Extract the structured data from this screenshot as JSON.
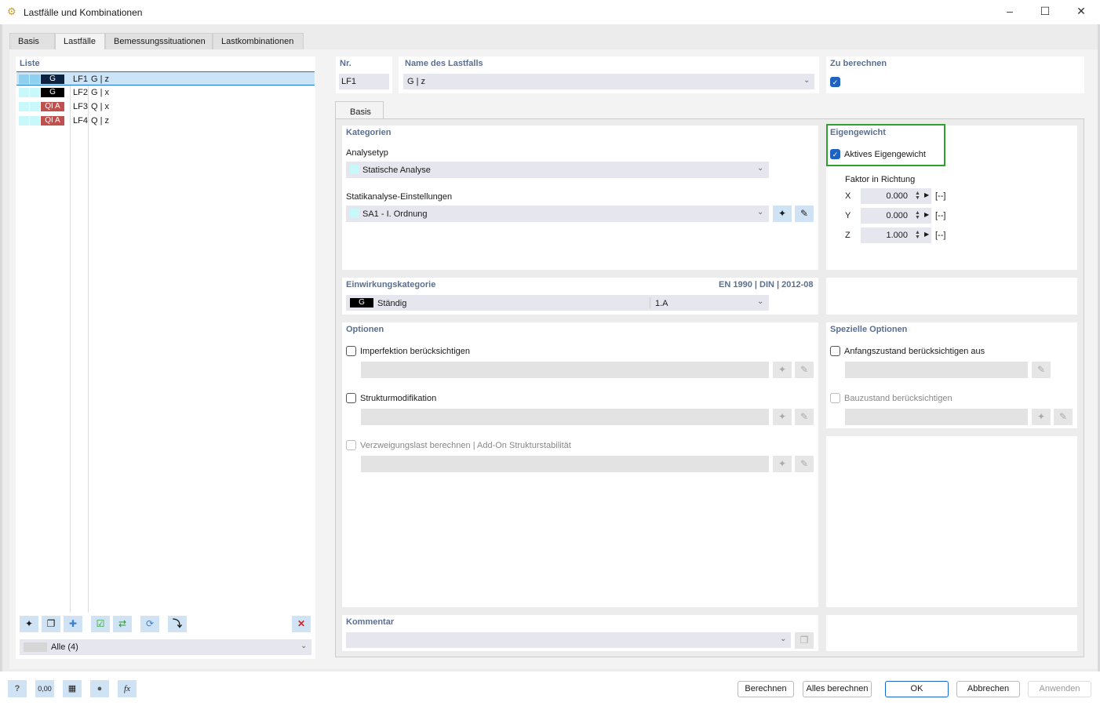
{
  "window": {
    "title": "Lastfälle und Kombinationen"
  },
  "tabs": [
    "Basis",
    "Lastfälle",
    "Bemessungssituationen",
    "Lastkombinationen"
  ],
  "list": {
    "title": "Liste",
    "items": [
      {
        "badge": "G",
        "badge_color": "#0b2240",
        "no": "LF1",
        "name": "G | z"
      },
      {
        "badge": "G",
        "badge_color": "#000000",
        "no": "LF2",
        "name": "G | x"
      },
      {
        "badge": "QI A",
        "badge_color": "#c0504d",
        "no": "LF3",
        "name": "Q | x"
      },
      {
        "badge": "QI A",
        "badge_color": "#c0504d",
        "no": "LF4",
        "name": "Q | z"
      }
    ],
    "filter": "Alle (4)"
  },
  "header": {
    "nr_label": "Nr.",
    "nr_value": "LF1",
    "name_label": "Name des Lastfalls",
    "name_value": "G | z",
    "calc_label": "Zu berechnen"
  },
  "subtab": "Basis",
  "kategorien": {
    "title": "Kategorien",
    "analysetyp_label": "Analysetyp",
    "analysetyp_value": "Statische Analyse",
    "settings_label": "Statikanalyse-Einstellungen",
    "settings_value": "SA1 - I. Ordnung"
  },
  "eigengewicht": {
    "title": "Eigengewicht",
    "active_label": "Aktives Eigengewicht",
    "factor_label": "Faktor in Richtung",
    "unit": "[--]",
    "factors": [
      {
        "axis": "X",
        "value": "0.000"
      },
      {
        "axis": "Y",
        "value": "0.000"
      },
      {
        "axis": "Z",
        "value": "1.000"
      }
    ]
  },
  "einwirkung": {
    "title": "Einwirkungskategorie",
    "norm": "EN 1990 | DIN | 2012-08",
    "badge": "G",
    "value": "Ständig",
    "code": "1.A"
  },
  "optionen": {
    "title": "Optionen",
    "imperfektion": "Imperfektion berücksichtigen",
    "struktur": "Strukturmodifikation",
    "verzweigung": "Verzweigungslast berechnen | Add-On Strukturstabilität"
  },
  "spezielle": {
    "title": "Spezielle Optionen",
    "anfang": "Anfangszustand berücksichtigen aus",
    "bauzustand": "Bauzustand berücksichtigen"
  },
  "kommentar": {
    "title": "Kommentar"
  },
  "footer": {
    "berechnen": "Berechnen",
    "alles": "Alles berechnen",
    "ok": "OK",
    "abbrechen": "Abbrechen",
    "anwenden": "Anwenden",
    "units_icon_text": "0,00"
  }
}
